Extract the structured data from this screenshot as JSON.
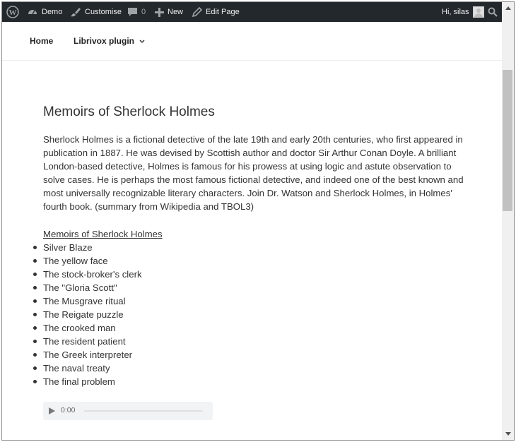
{
  "adminbar": {
    "site_name": "Demo",
    "customise": "Customise",
    "comments_count": "0",
    "new_label": "New",
    "edit_page": "Edit Page",
    "greeting": "Hi, silas"
  },
  "nav": {
    "home": "Home",
    "librivox": "Librivox plugin"
  },
  "content": {
    "title": "Memoirs of Sherlock Holmes",
    "summary": "Sherlock Holmes is a fictional detective of the late 19th and early 20th centuries, who first appeared in publication in 1887. He was devised by Scottish author and doctor Sir Arthur Conan Doyle. A brilliant London-based detective, Holmes is famous for his prowess at using logic and astute observation to solve cases. He is perhaps the most famous fictional detective, and indeed one of the best known and most universally recognizable literary characters. Join Dr. Watson and Sherlock Holmes, in Holmes' fourth book. (summary from Wikipedia and TBOL3)",
    "book_link": "Memoirs of Sherlock Holmes",
    "chapters": [
      "Silver Blaze",
      "The yellow face",
      "The stock-broker's clerk",
      "The \"Gloria Scott\"",
      "The Musgrave ritual",
      "The Reigate puzzle",
      "The crooked man",
      "The resident patient",
      "The Greek interpreter",
      "The naval treaty",
      "The final problem"
    ],
    "player_time": "0:00"
  }
}
